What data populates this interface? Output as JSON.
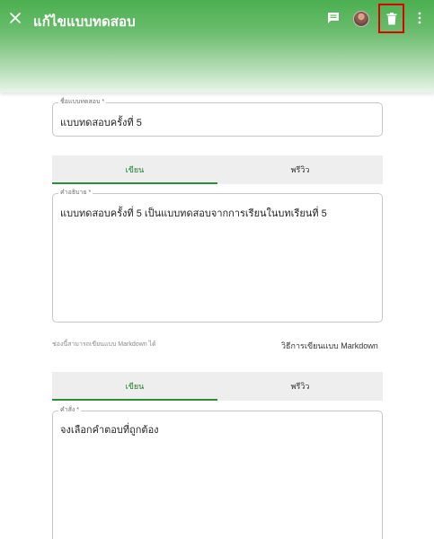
{
  "appbar": {
    "title": "แก้ไขแบบทดสอบ",
    "close_icon": "close-icon",
    "comment_icon": "comment-icon",
    "delete_icon": "trash-icon",
    "more_icon": "more-vertical-icon",
    "colors": {
      "primary": "#4caf50",
      "highlight": "#e00000"
    }
  },
  "form": {
    "name_label": "ชื่อแบบทดสอบ *",
    "name_value": "แบบทดสอบครั้งที่ 5",
    "description_label": "คำอธิบาย *",
    "description_value": "แบบทดสอบครั้งที่ 5 เป็นแบบทดสอบจากการเรียนในบทเรียนที่ 5",
    "markdown_hint": "ช่องนี้สามารถเขียนแบบ Markdown ได้",
    "markdown_link": "วิธีการเขียนแบบ Markdown",
    "instruction_label": "คำสั่ง *",
    "instruction_value": "จงเลือกคำตอบที่ถูกต้อง"
  },
  "tabs1": {
    "write": "เขียน",
    "preview": "พรีวิว"
  },
  "tabs2": {
    "write": "เขียน",
    "preview": "พรีวิว"
  }
}
